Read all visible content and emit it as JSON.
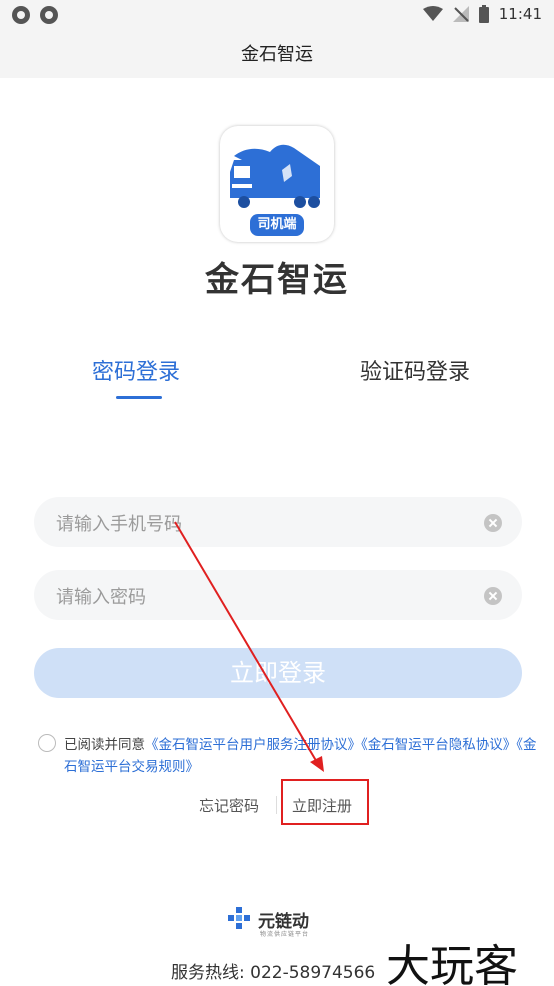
{
  "status_bar": {
    "time": "11:41",
    "icons": [
      "sync-icon",
      "sync-icon",
      "wifi-icon",
      "no-signal-icon",
      "battery-icon"
    ]
  },
  "header": {
    "title": "金石智运"
  },
  "logo": {
    "caption": "司机端",
    "truck_text": "元链动",
    "color": "#2d6fd6"
  },
  "app_name": "金石智运",
  "tabs": [
    {
      "label": "密码登录",
      "active": true
    },
    {
      "label": "验证码登录",
      "active": false
    }
  ],
  "form": {
    "phone_placeholder": "请输入手机号码",
    "password_placeholder": "请输入密码",
    "login_label": "立即登录"
  },
  "agreement": {
    "prefix": "已阅读并同意",
    "link1": "《金石智运平台用户服务注册协议》",
    "link2": "《金石智运平台隐私协议》",
    "link3": "《金石智运平台交易规则》"
  },
  "links": {
    "forgot": "忘记密码",
    "register": "立即注册"
  },
  "footer": {
    "brand": "元链动",
    "brand_sub": "物流供应链平台",
    "hotline": "服务热线: 022-58974566"
  },
  "watermark": "大玩客",
  "colors": {
    "accent": "#2d6fd6",
    "button_disabled": "#cfe0f7",
    "annotation": "#e02020"
  }
}
